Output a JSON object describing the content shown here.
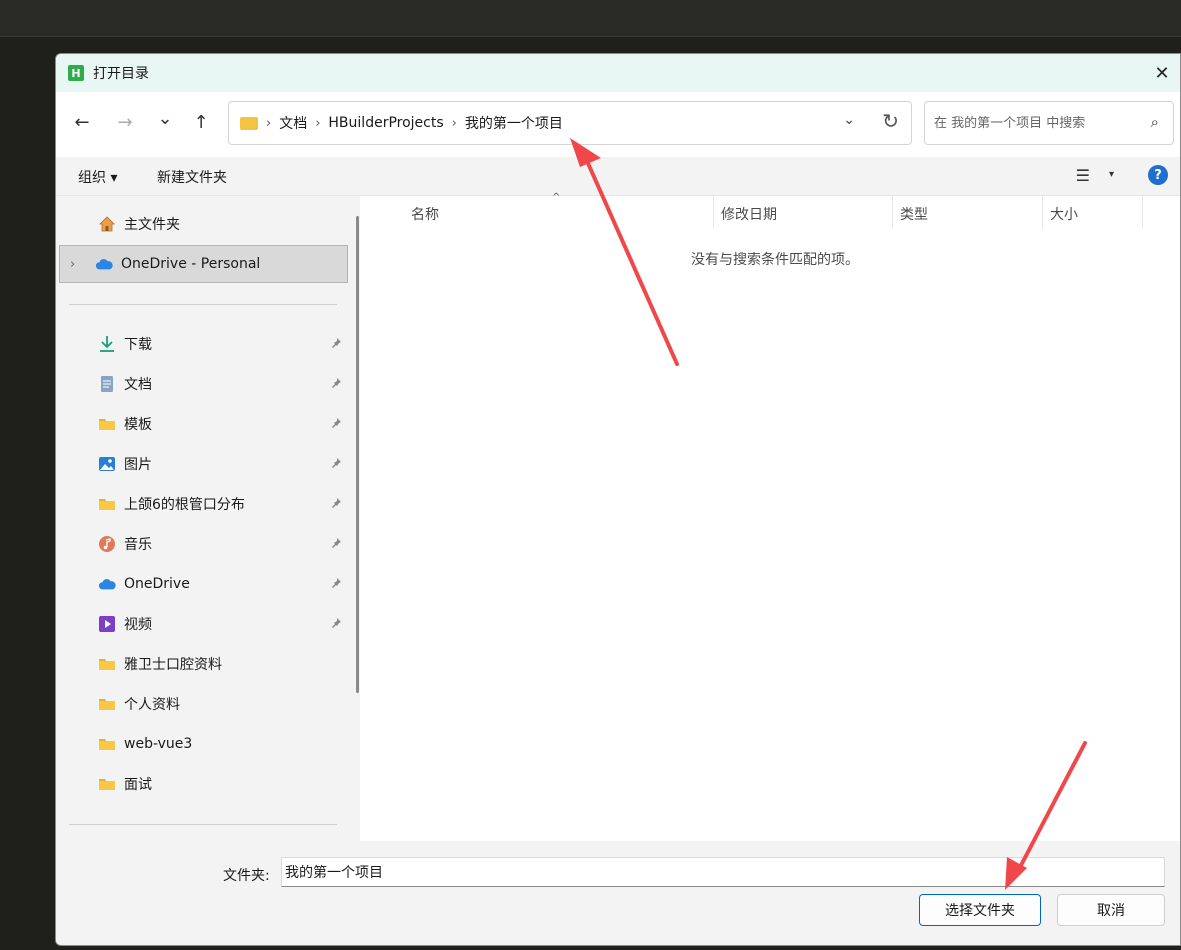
{
  "window": {
    "title": "打开目录",
    "app_icon_letter": "H",
    "close_symbol": "✕"
  },
  "nav": {
    "back_icon": "←",
    "forward_icon": "→",
    "recent_icon": "⌄",
    "up_icon": "↑"
  },
  "address": {
    "crumbs": [
      "文档",
      "HBuilderProjects",
      "我的第一个项目"
    ],
    "separator": "›",
    "dropdown_icon": "⌄",
    "refresh_icon": "↻"
  },
  "search": {
    "placeholder": "在 我的第一个项目 中搜索",
    "icon": "⌕"
  },
  "toolbar": {
    "organize_label": "组织 ▾",
    "new_folder_label": "新建文件夹",
    "view_icon": "☰",
    "view_dropdown": "▾",
    "help_label": "?"
  },
  "sidebar": {
    "home_label": "主文件夹",
    "onedrive_personal_label": "OneDrive - Personal",
    "expand_icon": "›",
    "quick_access": [
      {
        "label": "下载",
        "icon": "download-icon",
        "pinned": true
      },
      {
        "label": "文档",
        "icon": "document-icon",
        "pinned": true
      },
      {
        "label": "模板",
        "icon": "folder-icon",
        "pinned": true
      },
      {
        "label": "图片",
        "icon": "pictures-icon",
        "pinned": true
      },
      {
        "label": "上颌6的根管口分布",
        "icon": "folder-icon",
        "pinned": true
      },
      {
        "label": "音乐",
        "icon": "music-icon",
        "pinned": true
      },
      {
        "label": "OneDrive",
        "icon": "cloud-icon",
        "pinned": true
      },
      {
        "label": "视频",
        "icon": "video-icon",
        "pinned": true
      },
      {
        "label": "雅卫士口腔资料",
        "icon": "folder-icon",
        "pinned": false
      },
      {
        "label": "个人资料",
        "icon": "folder-icon",
        "pinned": false
      },
      {
        "label": "web-vue3",
        "icon": "folder-icon",
        "pinned": false
      },
      {
        "label": "面试",
        "icon": "folder-icon",
        "pinned": false
      }
    ],
    "pin_symbol": "📌"
  },
  "columns": {
    "name": "名称",
    "modified": "修改日期",
    "type": "类型",
    "size": "大小",
    "sort_arrow": "^"
  },
  "content": {
    "empty_message": "没有与搜索条件匹配的项。"
  },
  "footer": {
    "folder_label": "文件夹:",
    "folder_value": "我的第一个项目",
    "select_button": "选择文件夹",
    "cancel_button": "取消"
  },
  "colors": {
    "titlebar_bg": "#e8f6f4",
    "accent": "#0067c0",
    "arrow_red": "#f0484a",
    "folder_yellow": "#f7c846"
  }
}
